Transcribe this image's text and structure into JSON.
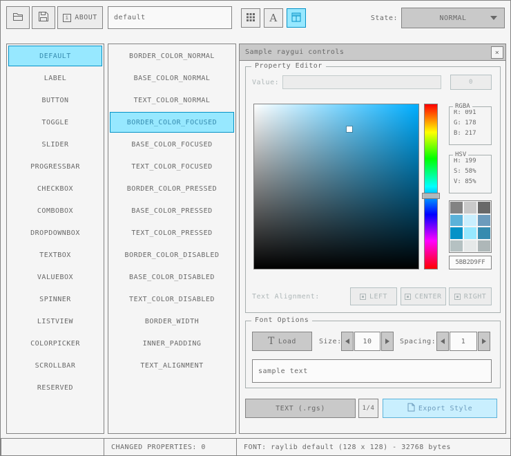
{
  "colors": {
    "background": "#f5f5f5",
    "border": "#838383",
    "text": "#686868",
    "pressed_border": "#0492c7",
    "pressed_base": "#97e8ff",
    "pressed_text": "#368baf",
    "focused_border": "#5bb2d9",
    "focused_base": "#c9effe",
    "focused_text": "#6c9bbc",
    "disabled_border": "#b5c1c2",
    "disabled_base": "#e6e9e9",
    "disabled_text": "#aeb7b8"
  },
  "toolbar": {
    "about_label": "ABOUT",
    "about_icon_glyph": "i",
    "style_name_value": "default",
    "state_label": "State:",
    "state_value": "NORMAL"
  },
  "controls_list": {
    "selected": "DEFAULT",
    "items": [
      "DEFAULT",
      "LABEL",
      "BUTTON",
      "TOGGLE",
      "SLIDER",
      "PROGRESSBAR",
      "CHECKBOX",
      "COMBOBOX",
      "DROPDOWNBOX",
      "TEXTBOX",
      "VALUEBOX",
      "SPINNER",
      "LISTVIEW",
      "COLORPICKER",
      "SCROLLBAR",
      "RESERVED"
    ]
  },
  "properties_list": {
    "selected": "BORDER_COLOR_FOCUSED",
    "items": [
      "BORDER_COLOR_NORMAL",
      "BASE_COLOR_NORMAL",
      "TEXT_COLOR_NORMAL",
      "BORDER_COLOR_FOCUSED",
      "BASE_COLOR_FOCUSED",
      "TEXT_COLOR_FOCUSED",
      "BORDER_COLOR_PRESSED",
      "BASE_COLOR_PRESSED",
      "TEXT_COLOR_PRESSED",
      "BORDER_COLOR_DISABLED",
      "BASE_COLOR_DISABLED",
      "TEXT_COLOR_DISABLED",
      "BORDER_WIDTH",
      "INNER_PADDING",
      "TEXT_ALIGNMENT"
    ]
  },
  "sample_window": {
    "title": "Sample raygui controls",
    "close_glyph": "×",
    "property_editor": {
      "group_label": "Property Editor",
      "value_label": "Value:",
      "value_input": "",
      "value_button": "0",
      "rgba": {
        "label": "RGBA",
        "r": "R: 091",
        "g": "G: 178",
        "b": "B: 217"
      },
      "hsv": {
        "label": "HSV",
        "h": "H: 199",
        "s": "S: 58%",
        "v": "V: 85%"
      },
      "hex_value": "5BB2D9FF",
      "picker": {
        "hue": 199,
        "saturation_pct": 58,
        "value_pct": 85,
        "selected_color": "#5bb2d9"
      },
      "palette": [
        "#838383",
        "#c9c9c9",
        "#686868",
        "#5bb2d9",
        "#c9effe",
        "#6c9bbc",
        "#0492c7",
        "#97e8ff",
        "#368baf",
        "#b5c1c2",
        "#e6e9e9",
        "#aeb7b8"
      ],
      "alignment_label": "Text Alignment:",
      "alignment_options": [
        "LEFT",
        "CENTER",
        "RIGHT"
      ]
    },
    "font_options": {
      "group_label": "Font Options",
      "load_button": "Load",
      "load_icon_glyph": "T",
      "size_label": "Size:",
      "size_value": "10",
      "spacing_label": "Spacing:",
      "spacing_value": "1",
      "sample_text": "sample text"
    },
    "export_row": {
      "format_button": "TEXT (.rgs)",
      "page_button": "1/4",
      "export_button": "Export Style"
    }
  },
  "statusbar": {
    "left": "",
    "changed_properties": "CHANGED PROPERTIES: 0",
    "font_info": "FONT: raylib default (128 x 128) - 32768 bytes"
  }
}
